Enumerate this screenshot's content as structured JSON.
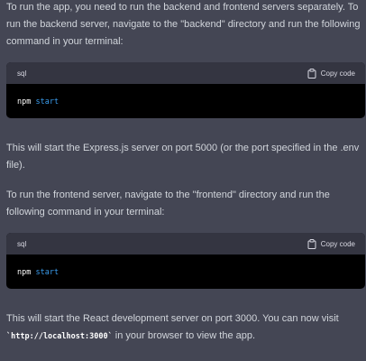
{
  "paragraph1": "To run the app, you need to run the backend and frontend servers separately. To run the backend server, navigate to the \"backend\" directory and run the following command in your terminal:",
  "code_block_1": {
    "language": "sql",
    "copy_label": "Copy code",
    "command": "npm",
    "argument": "start"
  },
  "paragraph2": "This will start the Express.js server on port 5000 (or the port specified in the .env file).",
  "paragraph3": "To run the frontend server, navigate to the \"frontend\" directory and run the following command in your terminal:",
  "code_block_2": {
    "language": "sql",
    "copy_label": "Copy code",
    "command": "npm",
    "argument": "start"
  },
  "paragraph4": {
    "before": "This will start the React development server on port 3000. You can now visit ",
    "url": "`http://localhost:3000`",
    "after": " in your browser to view the app."
  },
  "icons": {
    "copy": "clipboard-icon"
  },
  "colors": {
    "background": "#444654",
    "code_background": "#000000",
    "code_header": "#343541",
    "keyword": "#3b9eef",
    "text": "#d1d5db"
  }
}
